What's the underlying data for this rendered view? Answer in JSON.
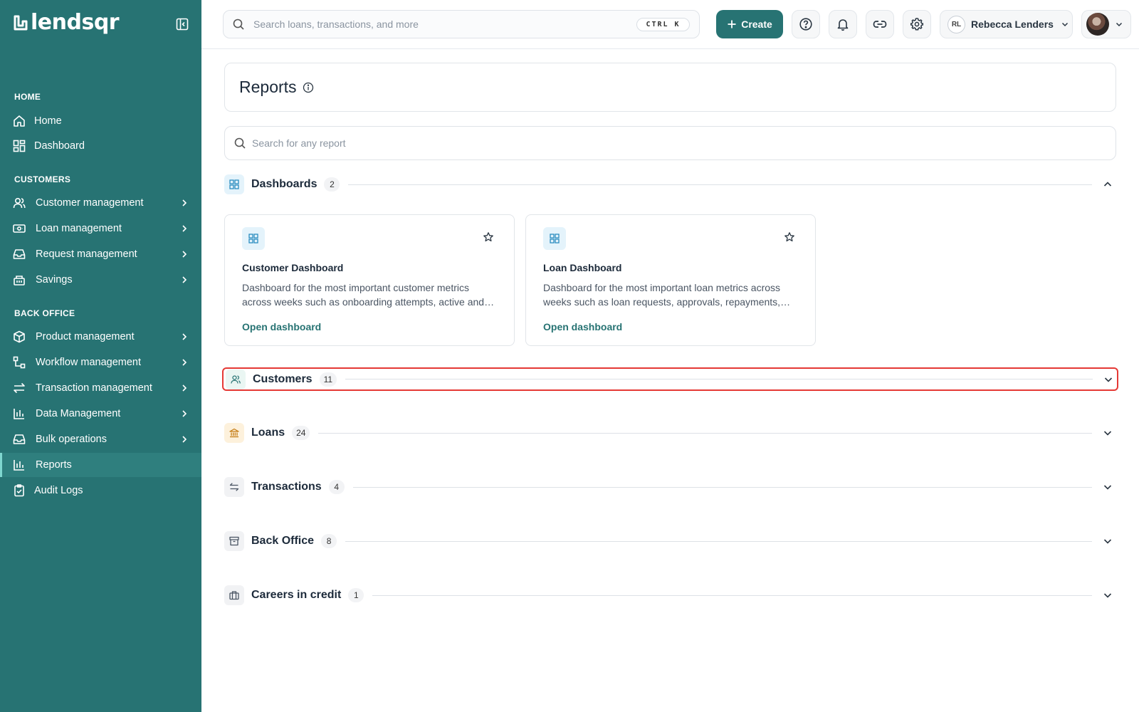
{
  "brand": {
    "name": "lendsqr"
  },
  "sidebar": {
    "sections": [
      {
        "title": "HOME"
      },
      {
        "title": "CUSTOMERS"
      },
      {
        "title": "BACK OFFICE"
      }
    ],
    "items": [
      {
        "label": "Home",
        "icon": "home-icon"
      },
      {
        "label": "Dashboard",
        "icon": "dashboard-icon"
      },
      {
        "label": "Customer management",
        "icon": "users-icon"
      },
      {
        "label": "Loan management",
        "icon": "banknote-icon"
      },
      {
        "label": "Request management",
        "icon": "inbox-icon"
      },
      {
        "label": "Savings",
        "icon": "savings-icon"
      },
      {
        "label": "Product management",
        "icon": "box-icon"
      },
      {
        "label": "Workflow management",
        "icon": "workflow-icon"
      },
      {
        "label": "Transaction management",
        "icon": "transfer-icon"
      },
      {
        "label": "Data Management",
        "icon": "bar-chart-icon"
      },
      {
        "label": "Bulk operations",
        "icon": "inbox-icon"
      },
      {
        "label": "Reports",
        "icon": "bar-chart-icon",
        "active": true
      },
      {
        "label": "Audit Logs",
        "icon": "clipboard-check-icon"
      }
    ]
  },
  "topbar": {
    "search_placeholder": "Search loans, transactions, and more",
    "shortcut": "CTRL K",
    "create_label": "Create",
    "user_initials": "RL",
    "user_name": "Rebecca Lenders"
  },
  "page": {
    "title": "Reports",
    "search_placeholder": "Search for any report"
  },
  "sections": [
    {
      "title": "Dashboards",
      "count": "2",
      "icon": "dashboard-icon",
      "expanded": true
    },
    {
      "title": "Customers",
      "count": "11",
      "icon": "users-icon",
      "expanded": false
    },
    {
      "title": "Loans",
      "count": "24",
      "icon": "bank-icon",
      "expanded": false
    },
    {
      "title": "Transactions",
      "count": "4",
      "icon": "transfer-icon",
      "expanded": false
    },
    {
      "title": "Back Office",
      "count": "8",
      "icon": "archive-icon",
      "expanded": false
    },
    {
      "title": "Careers in credit",
      "count": "1",
      "icon": "briefcase-icon",
      "expanded": false
    }
  ],
  "dashboards": [
    {
      "title": "Customer Dashboard",
      "description": "Dashboard for the most important customer metrics across weeks such as onboarding attempts, active and inactive customers",
      "link": "Open dashboard"
    },
    {
      "title": "Loan Dashboard",
      "description": "Dashboard for the most important loan metrics across weeks such as loan requests, approvals, repayments, and defaults",
      "link": "Open dashboard"
    }
  ],
  "colors": {
    "sidebar": "#277373",
    "accent": "#277373",
    "highlight": "#e53935"
  }
}
